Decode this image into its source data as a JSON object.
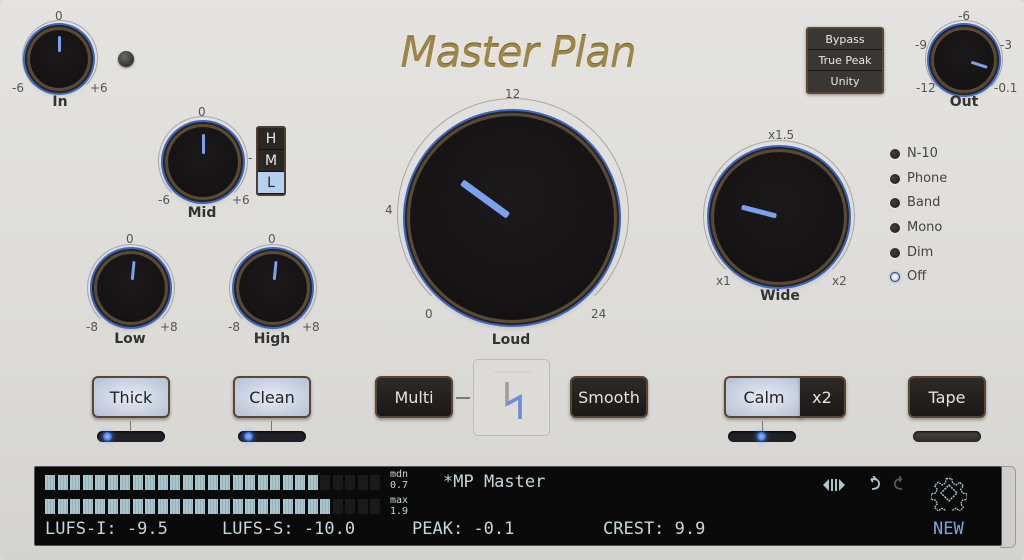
{
  "app_title": "Master Plan",
  "colors": {
    "accent_blue": "#3b66c4",
    "pointer_blue": "#7aa0ee",
    "title_gold": "#9c8648",
    "lcd_text": "#c5d6dc",
    "lcd_blue": "#7fa2e6"
  },
  "knobs": {
    "in": {
      "label": "In",
      "scale": [
        "0",
        "-6",
        "+6"
      ],
      "value_fraction": 0.5
    },
    "mid": {
      "label": "Mid",
      "scale": [
        "0",
        "-6",
        "+6"
      ],
      "value_fraction": 0.5
    },
    "low": {
      "label": "Low",
      "scale": [
        "0",
        "-8",
        "+8"
      ],
      "value_fraction": 0.52
    },
    "high": {
      "label": "High",
      "scale": [
        "0",
        "-8",
        "+8"
      ],
      "value_fraction": 0.52
    },
    "loud": {
      "label": "Loud",
      "scale": [
        "12",
        "4",
        "0",
        "24"
      ],
      "value_fraction": 0.3
    },
    "wide": {
      "label": "Wide",
      "scale": [
        "x1.5",
        "x1",
        "x2"
      ],
      "value_fraction": 0.22
    },
    "out": {
      "label": "Out",
      "scale": [
        "-6",
        "-9",
        "-3",
        "-12",
        "-0.1"
      ],
      "value_fraction": 0.9
    }
  },
  "band_selector": {
    "items": [
      "H",
      "M",
      "L"
    ],
    "selected": "L",
    "dash": "-"
  },
  "top_toggles": [
    "Bypass",
    "True Peak",
    "Unity"
  ],
  "monitor_modes": {
    "items": [
      "N-10",
      "Phone",
      "Band",
      "Mono",
      "Dim",
      "Off"
    ],
    "selected": "Off"
  },
  "buttons": {
    "thick": {
      "label": "Thick",
      "active": true,
      "slider_fraction": 0.1
    },
    "clean": {
      "label": "Clean",
      "active": true,
      "slider_fraction": 0.1
    },
    "multi": {
      "label": "Multi",
      "active": false
    },
    "smooth": {
      "label": "Smooth",
      "active": false
    },
    "calm": {
      "label": "Calm",
      "active": true,
      "slider_fraction": 0.5
    },
    "x2": {
      "label": "x2",
      "active": false
    },
    "tape": {
      "label": "Tape",
      "active": false
    }
  },
  "logo_icon": "mp-logo-icon",
  "display": {
    "meter_top": {
      "lit": 22,
      "total": 27,
      "label": "mdn",
      "value": "0.7"
    },
    "meter_bottom": {
      "lit": 23,
      "total": 27,
      "label": "max",
      "value": "1.9"
    },
    "preset_name": "*MP Master",
    "stats": {
      "lufs_i": "LUFS-I: -9.5",
      "lufs_s": "LUFS-S: -10.0",
      "peak": "PEAK: -0.1",
      "crest": "CREST: 9.9"
    },
    "icons": [
      "ab-compare-icon",
      "undo-icon",
      "redo-icon",
      "gear-icon"
    ],
    "new_label": "NEW"
  }
}
